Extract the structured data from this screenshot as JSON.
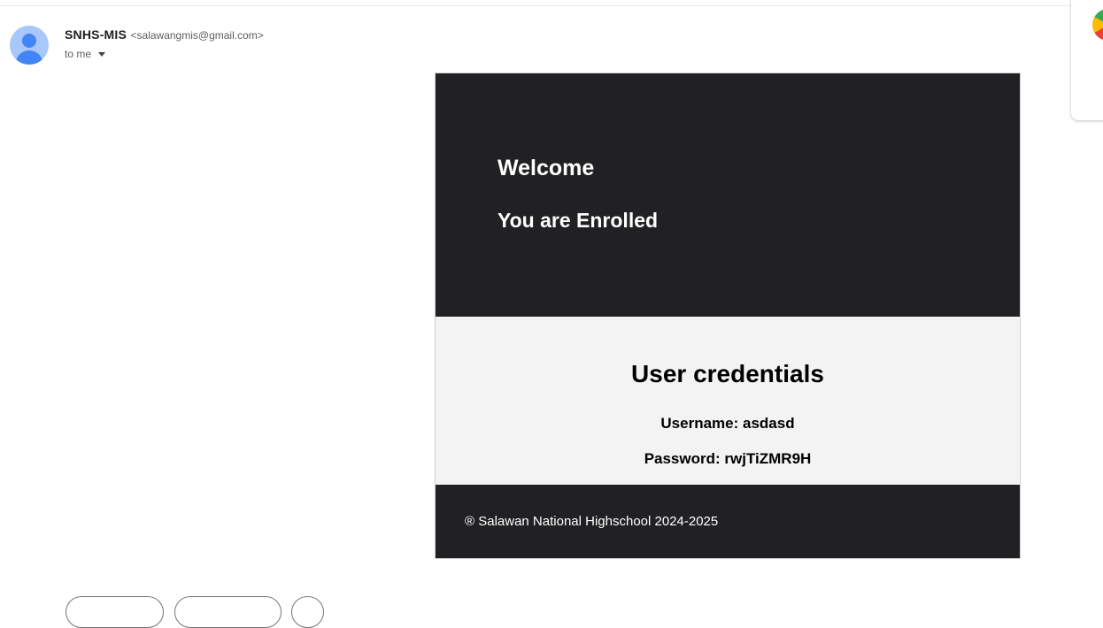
{
  "message": {
    "sender": {
      "name": "SNHS-MIS",
      "email": "<salawangmis@gmail.com>",
      "avatar_icon": "person-icon"
    },
    "recipient_label": "to me",
    "recipient_toggle_icon": "caret-down-icon"
  },
  "email_body": {
    "hero": {
      "welcome": "Welcome",
      "status": "You are Enrolled",
      "background_color": "#212124"
    },
    "credentials": {
      "title": "User credentials",
      "username": "Username: asdasd",
      "password": "Password: rwjTiZMR9H",
      "background_color": "#f3f3f3"
    },
    "footer": {
      "text": "® Salawan National Highschool 2024-2025"
    }
  },
  "actions": {
    "reply_icon": "reply-icon",
    "forward_icon": "forward-icon",
    "emoji_icon": "emoji-icon"
  }
}
